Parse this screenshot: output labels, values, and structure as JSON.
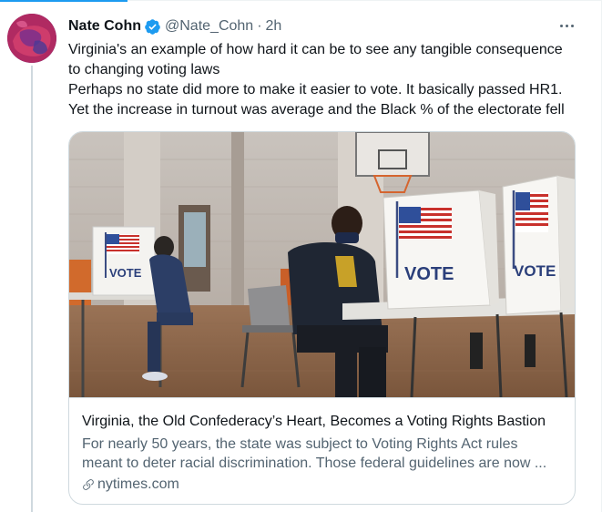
{
  "tweet": {
    "author_name": "Nate Cohn",
    "handle": "@Nate_Cohn",
    "separator": "·",
    "time": "2h",
    "lines": [
      "Virginia's an example of how hard it can be to see any tangible consequence",
      "to changing voting laws",
      "Perhaps no state did more to make it easier to vote. It basically passed HR1.",
      "Yet the increase in turnout was average and the Black % of the electorate fell"
    ]
  },
  "card": {
    "image_booth_label": "VOTE",
    "title": "Virginia, the Old Confederacy’s Heart, Becomes a Voting Rights Bastion",
    "description_lines": [
      "For nearly 50 years, the state was subject to Voting Rights Act rules",
      "meant to deter racial discrimination. Those federal guidelines are now ..."
    ],
    "domain": "nytimes.com"
  },
  "icons": {
    "verified": "verified-badge-icon",
    "more": "more-options-icon",
    "link": "link-icon"
  },
  "colors": {
    "accent_blue": "#1d9bf0",
    "text_primary": "#0f1419",
    "text_secondary": "#536471",
    "border": "#cfd9de"
  }
}
